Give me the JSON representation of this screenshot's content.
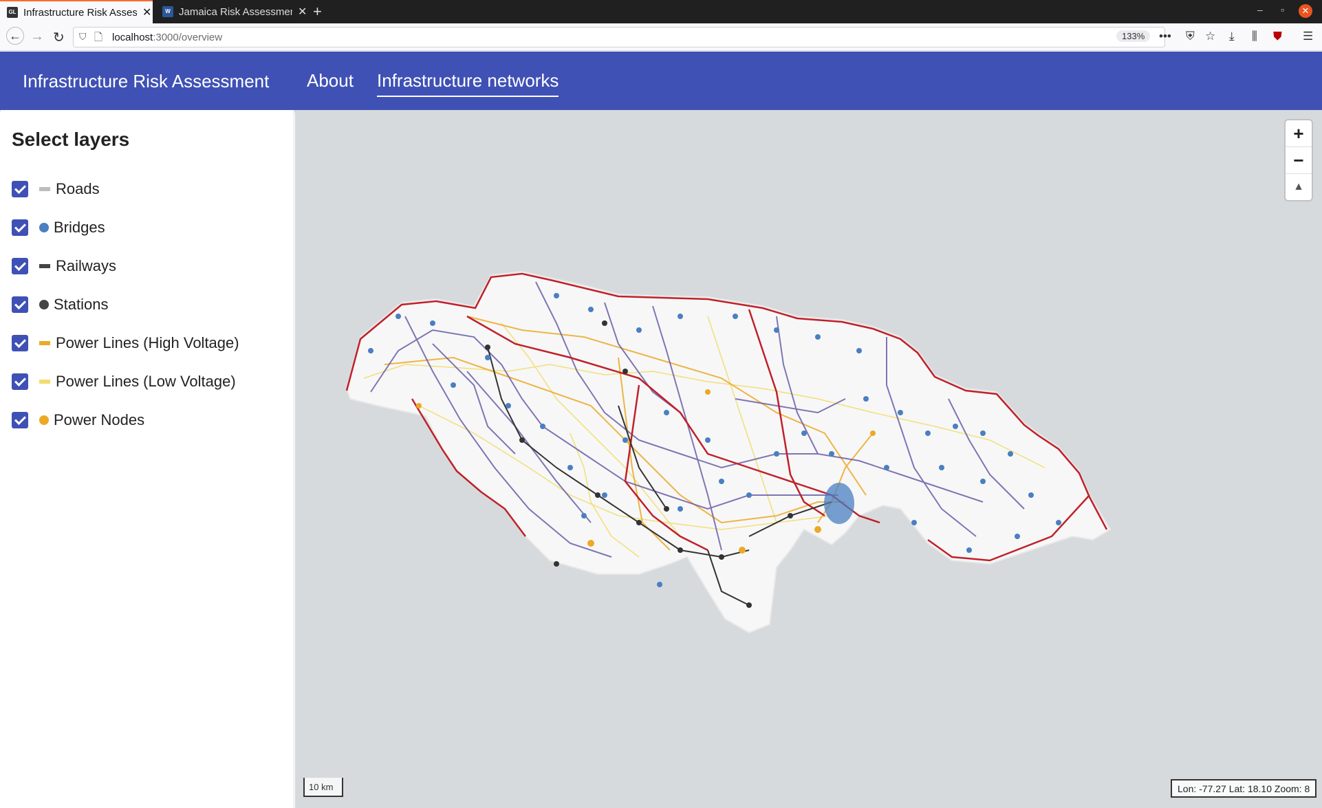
{
  "browser": {
    "tabs": [
      {
        "title": "Infrastructure Risk Assessment",
        "favicon": "GL",
        "active": true
      },
      {
        "title": "Jamaica Risk Assessment",
        "favicon": "W",
        "active": false
      }
    ],
    "url_host": "localhost",
    "url_path": ":3000/overview",
    "zoom_level": "133%"
  },
  "app": {
    "brand": "Infrastructure Risk Assessment",
    "nav": [
      {
        "label": "About",
        "active": false
      },
      {
        "label": "Infrastructure networks",
        "active": true
      }
    ],
    "header_color": "#3f51b5"
  },
  "sidebar": {
    "title": "Select layers",
    "layers": [
      {
        "label": "Roads",
        "checked": true,
        "swatch": "line",
        "color": "#bdbdbd"
      },
      {
        "label": "Bridges",
        "checked": true,
        "swatch": "dot",
        "color": "#4a7fc1"
      },
      {
        "label": "Railways",
        "checked": true,
        "swatch": "line",
        "color": "#444444"
      },
      {
        "label": "Stations",
        "checked": true,
        "swatch": "dot",
        "color": "#444444"
      },
      {
        "label": "Power Lines (High Voltage)",
        "checked": true,
        "swatch": "line",
        "color": "#eca926"
      },
      {
        "label": "Power Lines (Low Voltage)",
        "checked": true,
        "swatch": "line",
        "color": "#f1dd6d"
      },
      {
        "label": "Power Nodes",
        "checked": true,
        "swatch": "dot",
        "color": "#eca926"
      }
    ]
  },
  "map": {
    "zoom_in": "+",
    "zoom_out": "−",
    "compass": "▲",
    "scale_label": "10 km",
    "coords_label": "Lon: -77.27 Lat: 18.10 Zoom: 8",
    "colors": {
      "sea": "#d6dadc",
      "land": "#f7f7f7",
      "trunk_road": "#c0202a",
      "secondary_road": "#6b5ea8",
      "power_line": "#eca926",
      "railway": "#333333",
      "bridge": "#4a7fc1"
    }
  }
}
